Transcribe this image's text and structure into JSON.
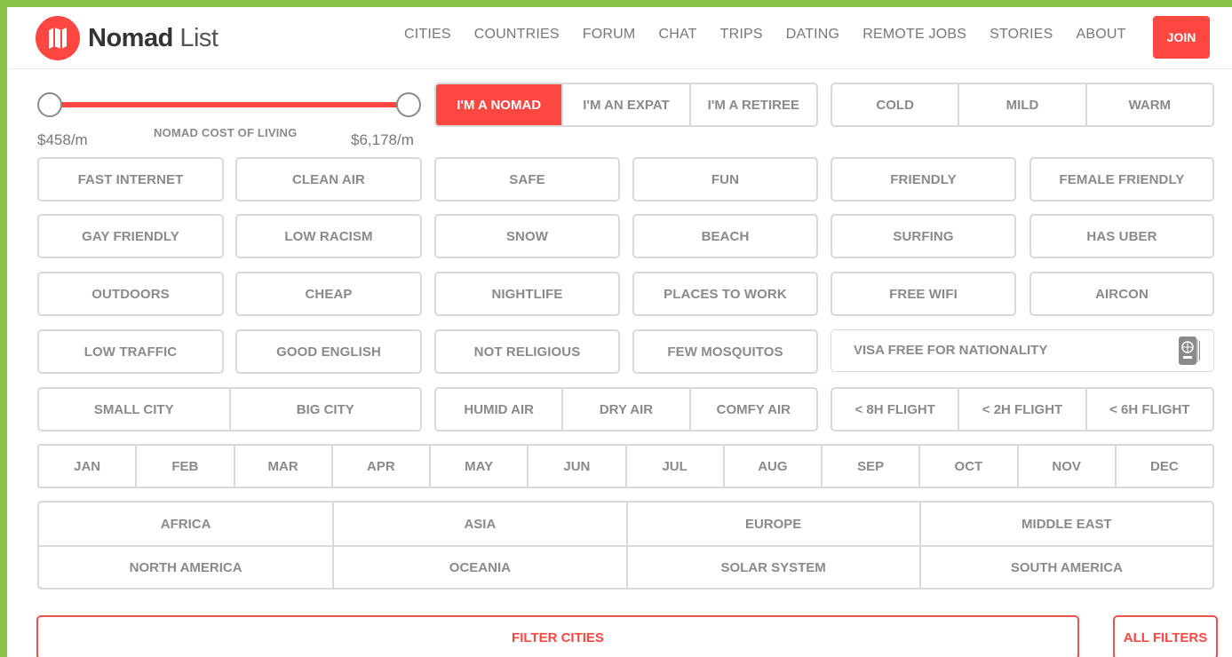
{
  "brand": {
    "bold": "Nomad",
    "light": "List"
  },
  "nav": [
    "CITIES",
    "COUNTRIES",
    "FORUM",
    "CHAT",
    "TRIPS",
    "DATING",
    "REMOTE JOBS",
    "STORIES",
    "ABOUT"
  ],
  "join_label": "JOIN",
  "cost_slider": {
    "min_label": "$458/m",
    "max_label": "$6,178/m",
    "label": "NOMAD COST OF LIVING"
  },
  "personas": {
    "items": [
      "I'M A NOMAD",
      "I'M AN EXPAT",
      "I'M A RETIREE"
    ],
    "selected": "I'M A NOMAD"
  },
  "climate": [
    "COLD",
    "MILD",
    "WARM"
  ],
  "filters": {
    "row1": [
      "FAST INTERNET",
      "CLEAN AIR",
      "SAFE",
      "FUN",
      "FRIENDLY",
      "FEMALE FRIENDLY"
    ],
    "row2": [
      "GAY FRIENDLY",
      "LOW RACISM",
      "SNOW",
      "BEACH",
      "SURFING",
      "HAS UBER"
    ],
    "row3": [
      "OUTDOORS",
      "CHEAP",
      "NIGHTLIFE",
      "PLACES TO WORK",
      "FREE WIFI",
      "AIRCON"
    ],
    "row4": [
      "LOW TRAFFIC",
      "GOOD ENGLISH",
      "NOT RELIGIOUS",
      "FEW MOSQUITOS"
    ]
  },
  "visa_placeholder": "VISA FREE FOR NATIONALITY",
  "city_size": [
    "SMALL CITY",
    "BIG CITY"
  ],
  "humidity": [
    "HUMID AIR",
    "DRY AIR",
    "COMFY AIR"
  ],
  "flights": [
    "< 8H FLIGHT",
    "< 2H FLIGHT",
    "< 6H FLIGHT"
  ],
  "months": [
    "JAN",
    "FEB",
    "MAR",
    "APR",
    "MAY",
    "JUN",
    "JUL",
    "AUG",
    "SEP",
    "OCT",
    "NOV",
    "DEC"
  ],
  "regions": [
    "AFRICA",
    "ASIA",
    "EUROPE",
    "MIDDLE EAST",
    "NORTH AMERICA",
    "OCEANIA",
    "SOLAR SYSTEM",
    "SOUTH AMERICA"
  ],
  "filter_cities_label": "FILTER CITIES",
  "all_filters_label": "ALL FILTERS",
  "colors": {
    "accent": "#ff4742",
    "border": "#d9d9d9",
    "text": "#8a8a8a",
    "frame": "#8bc34a"
  }
}
